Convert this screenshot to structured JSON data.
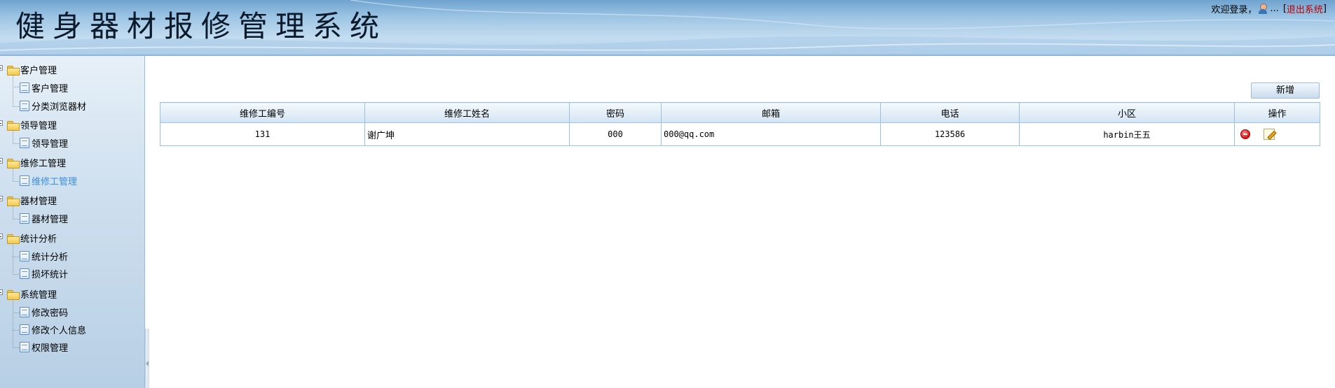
{
  "header": {
    "system_title": "健身器材报修管理系统",
    "welcome_text": "欢迎登录，",
    "username": "...",
    "logout_prefix": "[",
    "logout_label": "退出系统",
    "logout_suffix": "]"
  },
  "sidebar": {
    "groups": [
      {
        "label": "客户管理",
        "items": [
          "客户管理",
          "分类浏览器材"
        ]
      },
      {
        "label": "领导管理",
        "items": [
          "领导管理"
        ]
      },
      {
        "label": "维修工管理",
        "items": [
          "维修工管理"
        ]
      },
      {
        "label": "器材管理",
        "items": [
          "器材管理"
        ]
      },
      {
        "label": "统计分析",
        "items": [
          "统计分析",
          "损坏统计"
        ]
      },
      {
        "label": "系统管理",
        "items": [
          "修改密码",
          "修改个人信息",
          "权限管理"
        ]
      }
    ],
    "active_item": "维修工管理"
  },
  "toolbar": {
    "add_label": "新增"
  },
  "table": {
    "columns": [
      "维修工编号",
      "维修工姓名",
      "密码",
      "邮箱",
      "电话",
      "小区",
      "操作"
    ],
    "rows": [
      {
        "id": "131",
        "name": "谢广坤",
        "password": "000",
        "email": "000@qq.com",
        "phone": "123586",
        "community": "harbin王五"
      }
    ]
  },
  "colors": {
    "header_gradient_top": "#6fa3cf",
    "active_link": "#3b8fe0",
    "logout": "#c00000",
    "table_border": "#9cc0dd"
  },
  "icons": [
    "user-icon",
    "folder-icon",
    "document-icon",
    "delete-icon",
    "edit-icon"
  ]
}
